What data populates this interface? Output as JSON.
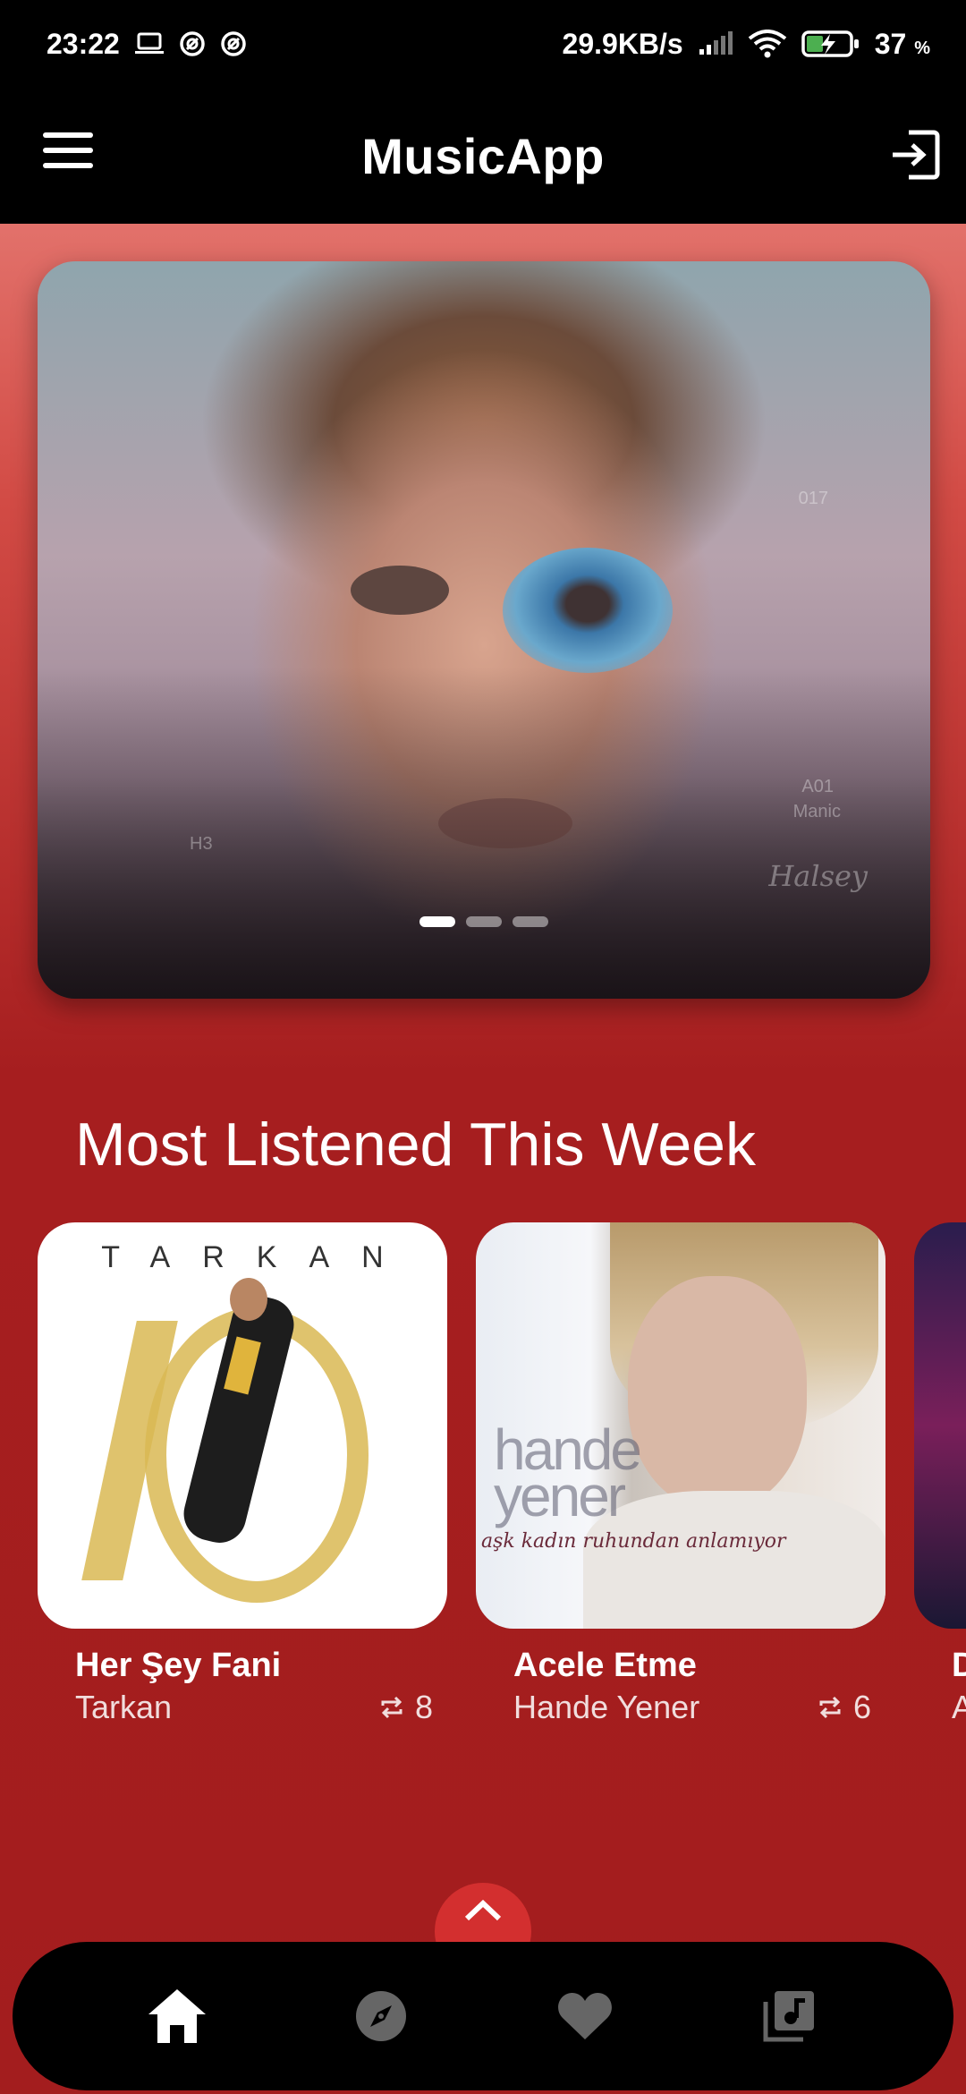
{
  "status_bar": {
    "time": "23:22",
    "network_speed": "29.9KB/s",
    "battery_percent": "37",
    "battery_unit": "%",
    "icons": [
      "laptop-icon",
      "at-icon",
      "at-icon",
      "signal-icon",
      "wifi-icon",
      "battery-charging-icon"
    ]
  },
  "app_bar": {
    "title": "MusicApp",
    "menu_icon": "hamburger-menu-icon",
    "logout_icon": "logout-icon"
  },
  "hero": {
    "text_017": "017",
    "text_a01": "A01",
    "text_manic": "Manic",
    "text_h3": "H3",
    "signature": "Halsey",
    "slides_count": 3,
    "active_slide": 1
  },
  "section": {
    "title": "Most Listened This Week"
  },
  "songs": [
    {
      "title": "Her Şey Fani",
      "artist": "Tarkan",
      "plays": "8",
      "cover_text": "TARKAN"
    },
    {
      "title": "Acele Etme",
      "artist": "Hande Yener",
      "plays": "6",
      "cover_logo_line1": "hande",
      "cover_logo_line2": "yener",
      "cover_tagline": "aşk kadın ruhundan anlamıyor"
    },
    {
      "title": "D",
      "artist": "A"
    }
  ],
  "bottom_nav": {
    "items": [
      "home-icon",
      "explore-icon",
      "favorites-icon",
      "library-icon"
    ],
    "active": "home-icon"
  },
  "colors": {
    "bar_background": "#000000",
    "gradient_top": "#ef9089",
    "gradient_bottom": "#a31d1e",
    "accent": "#d32f2f"
  }
}
